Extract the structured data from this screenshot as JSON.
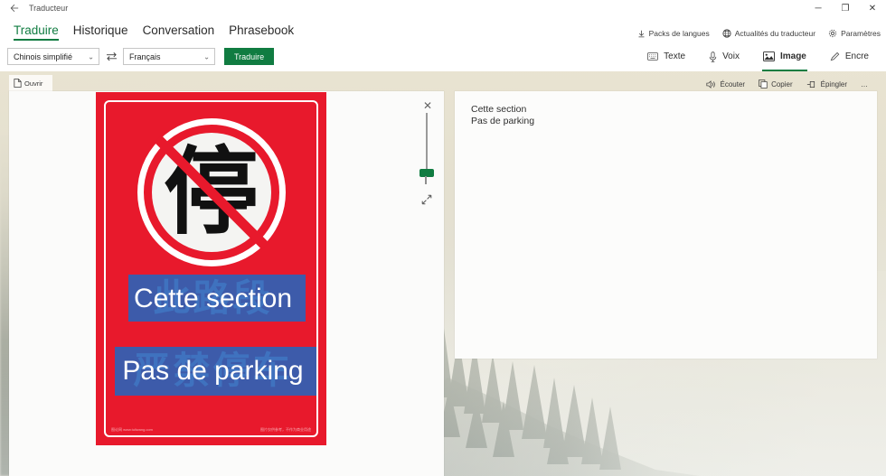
{
  "window": {
    "back_icon": "back-arrow-icon",
    "title": "Traducteur",
    "minimize": "─",
    "maximize": "❐",
    "close": "✕"
  },
  "nav": {
    "tabs": [
      {
        "label": "Traduire",
        "active": true
      },
      {
        "label": "Historique",
        "active": false
      },
      {
        "label": "Conversation",
        "active": false
      },
      {
        "label": "Phrasebook",
        "active": false
      }
    ],
    "actions": [
      {
        "label": "Packs de langues",
        "icon": "download-icon"
      },
      {
        "label": "Actualités du traducteur",
        "icon": "globe-icon"
      },
      {
        "label": "Paramètres",
        "icon": "gear-icon"
      }
    ]
  },
  "toolbar": {
    "source_language": "Chinois simplifié",
    "target_language": "Français",
    "swap_icon": "swap-arrows-icon",
    "translate_label": "Traduire",
    "chevron": "⌄",
    "accent_color": "#107c41",
    "modes": [
      {
        "label": "Texte",
        "icon": "keyboard-icon",
        "active": false
      },
      {
        "label": "Voix",
        "icon": "microphone-icon",
        "active": false
      },
      {
        "label": "Image",
        "icon": "image-icon",
        "active": true
      },
      {
        "label": "Encre",
        "icon": "pen-icon",
        "active": false
      }
    ]
  },
  "image_panel": {
    "open_tab_label": "Ouvrir",
    "open_tab_icon": "document-icon",
    "close_icon": "✕",
    "expand_icon": "expand-arrows-icon",
    "zoom_slider_value": 12
  },
  "sign": {
    "background_color": "#e8192c",
    "roundel_character": "停",
    "original_lines": [
      "此路段",
      "严禁停车"
    ],
    "overlay_lines": [
      "Cette section",
      "Pas de parking"
    ],
    "overlay_box_color": "#2a63b8",
    "watermark_left": "图论网 www.tuliwang.com",
    "watermark_right": "图片仅供参考，不作为商业用途"
  },
  "result": {
    "toolbar": [
      {
        "label": "Écouter",
        "icon": "speaker-icon"
      },
      {
        "label": "Copier",
        "icon": "copy-icon"
      },
      {
        "label": "Épingler",
        "icon": "pin-icon"
      },
      {
        "label": "…",
        "icon": "more-icon"
      }
    ],
    "translation": "Cette section\nPas de parking"
  }
}
